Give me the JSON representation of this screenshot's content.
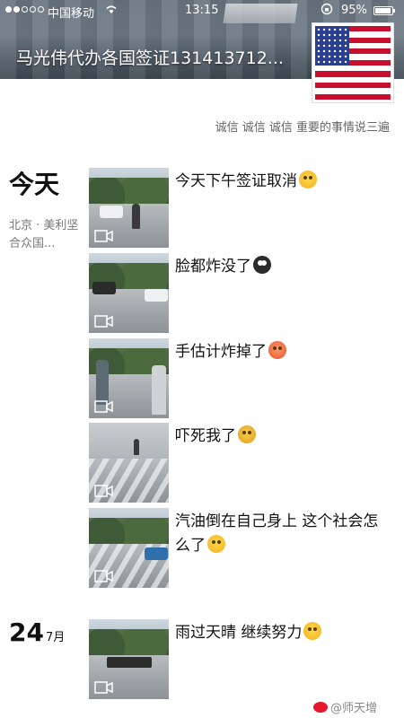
{
  "status_bar": {
    "signal_dots": 5,
    "signal_filled": 2,
    "carrier": "中国移动",
    "time": "13:15",
    "battery_percent": "95%",
    "battery_level": 0.95,
    "icons": [
      "wifi-icon",
      "orientation-lock-icon",
      "battery-icon"
    ]
  },
  "profile": {
    "name": "马光伟代办各国签证131413712...",
    "signature": "诚信 诚信 诚信 重要的事情说三遍",
    "avatar_icon": "us-flag-avatar"
  },
  "feed": {
    "days": [
      {
        "day_label": "今天",
        "month_label": "",
        "location": "北京 · 美利坚合众国...",
        "posts": [
          {
            "text": "今天下午签证取消",
            "emoji": "smirk-emoji"
          },
          {
            "text": "脸都炸没了",
            "emoji": "owl-emoji"
          },
          {
            "text": "手估计炸掉了",
            "emoji": "angry-face-emoji"
          },
          {
            "text": "吓死我了",
            "emoji": "screaming-face-emoji"
          },
          {
            "text": "汽油倒在自己身上 这个社会怎么了",
            "emoji": "smirk-emoji"
          }
        ]
      },
      {
        "day_label": "24",
        "month_label": "7月",
        "location": "",
        "posts": [
          {
            "text": "雨过天晴 继续努力",
            "emoji": "smile-emoji"
          }
        ]
      }
    ]
  },
  "watermark": "@师天增"
}
